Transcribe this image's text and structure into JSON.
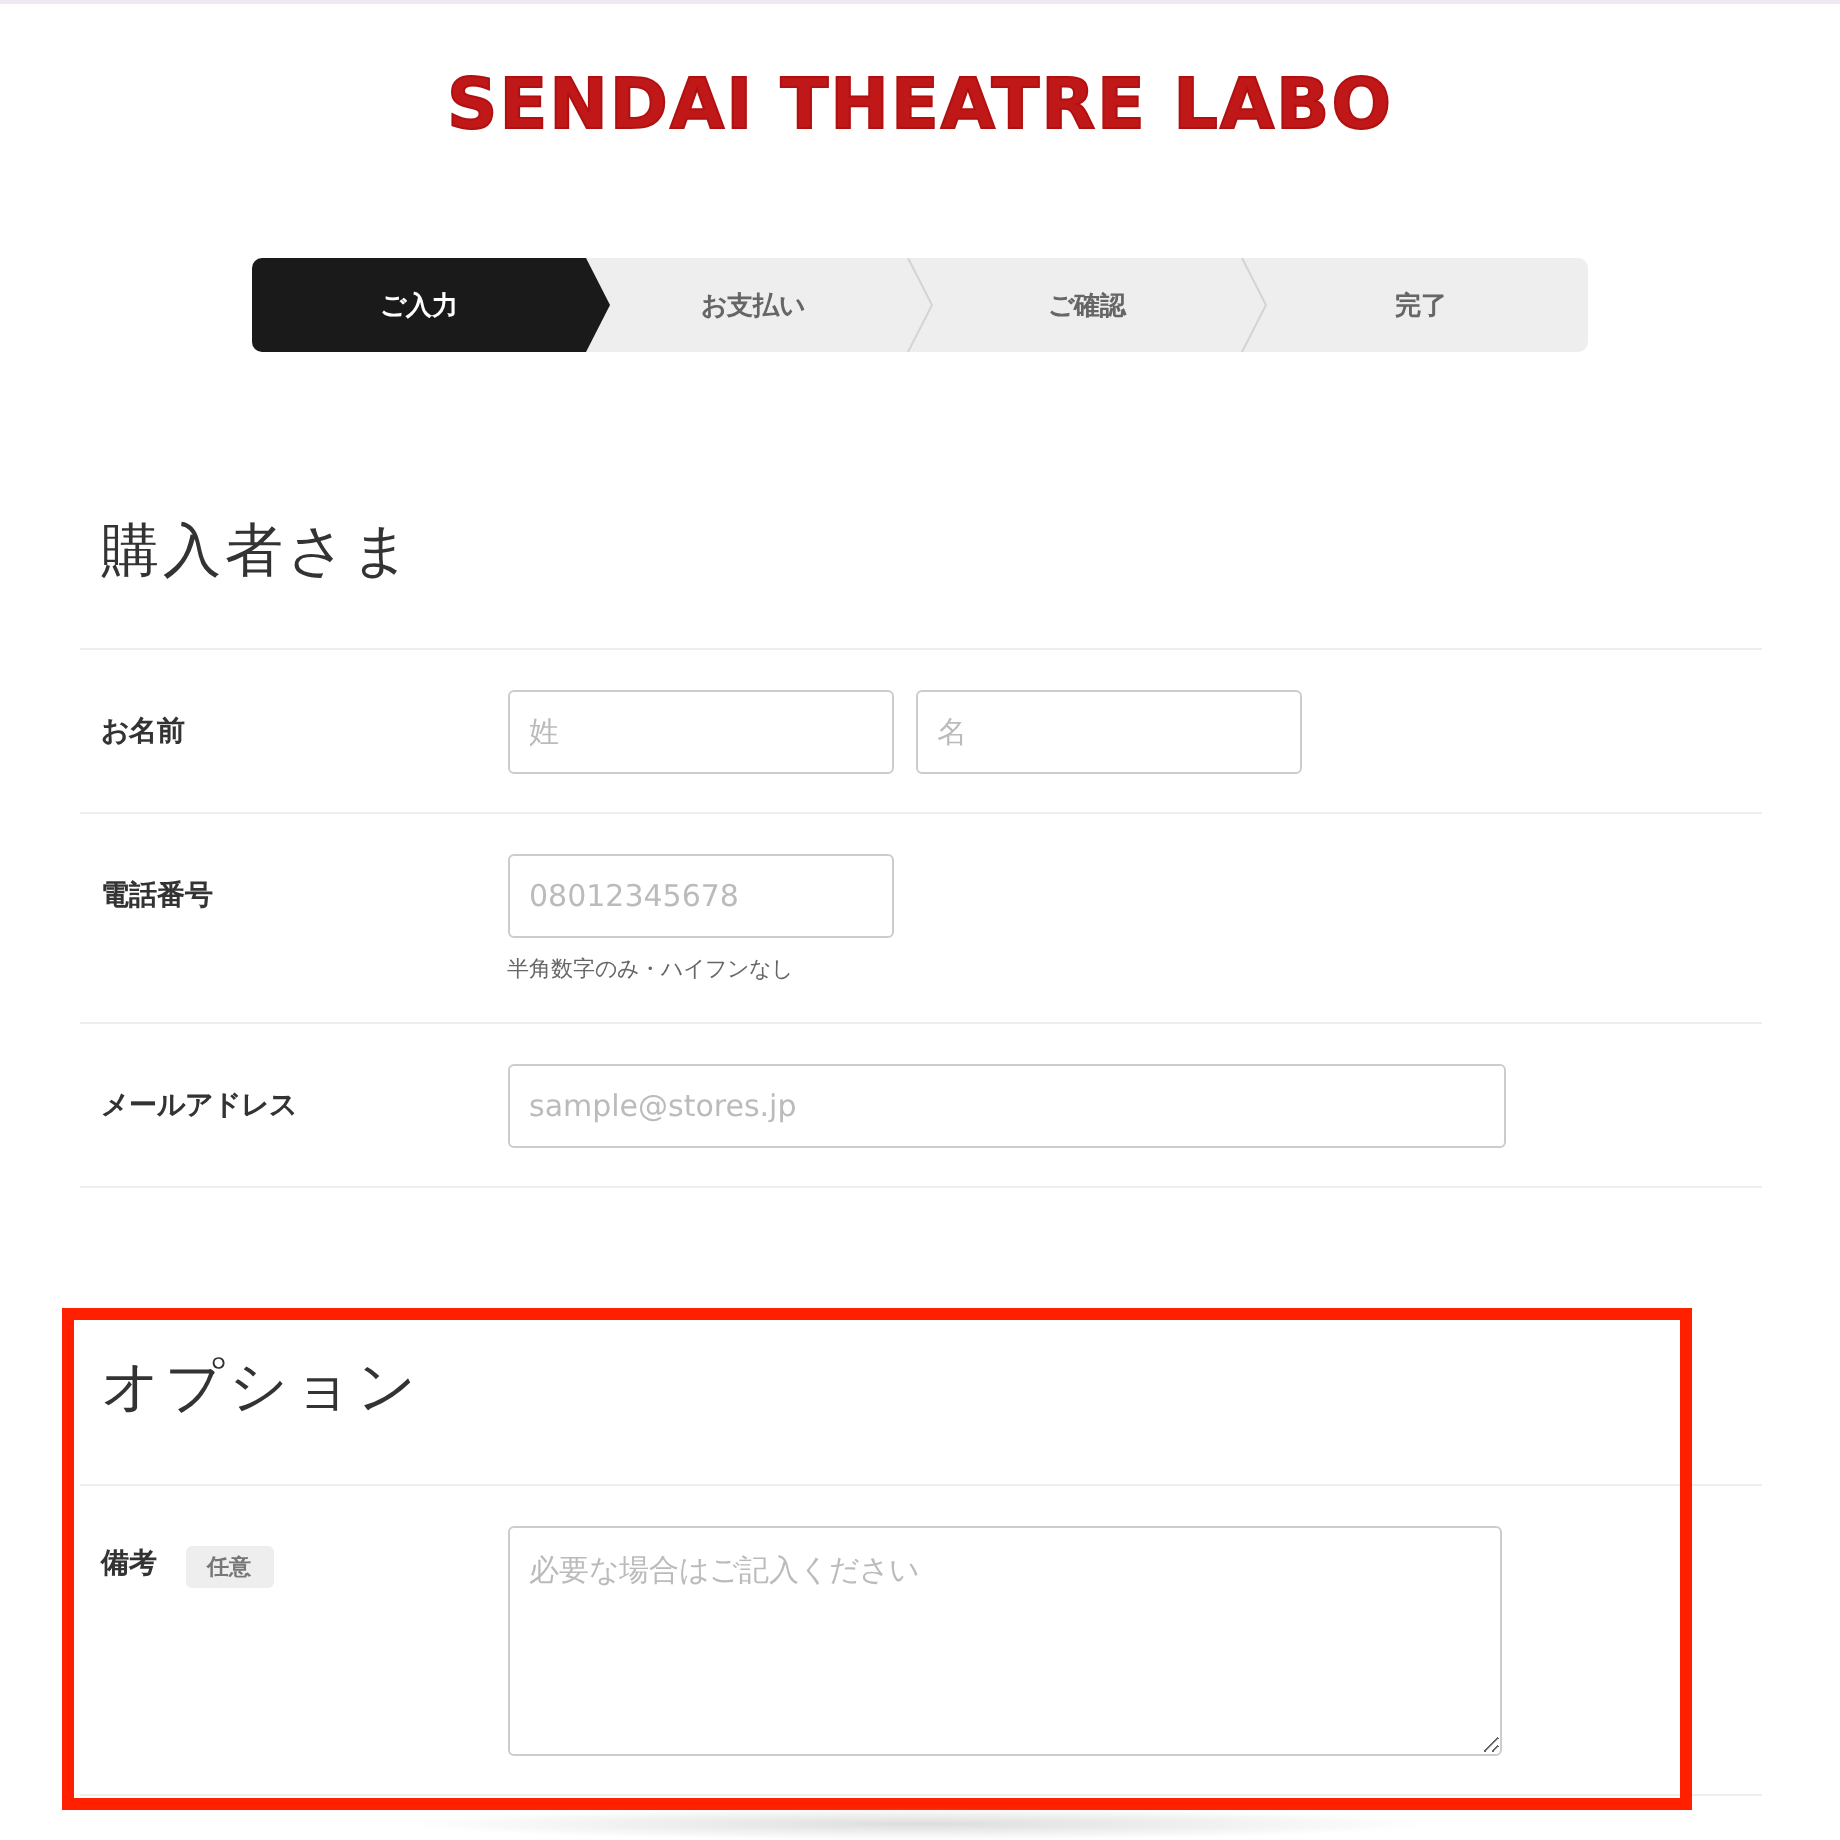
{
  "logo": {
    "text": "SENDAI THEATRE LABO"
  },
  "steps": [
    {
      "label": "ご入力",
      "selected": true
    },
    {
      "label": "お支払い",
      "selected": false
    },
    {
      "label": "ご確認",
      "selected": false
    },
    {
      "label": "完了",
      "selected": false
    }
  ],
  "sections": [
    {
      "title": "購入者さま",
      "highlighted": false,
      "rows": [
        {
          "label": "お名前",
          "fields": [
            {
              "kind": "short",
              "placeholder": "姓"
            },
            {
              "kind": "short",
              "placeholder": "名"
            }
          ]
        },
        {
          "label": "電話番号",
          "fields": [
            {
              "kind": "short",
              "placeholder": "08012345678"
            }
          ],
          "hint": "半角数字のみ・ハイフンなし"
        },
        {
          "label": "メールアドレス",
          "fields": [
            {
              "kind": "wide",
              "placeholder": "sample@stores.jp"
            }
          ]
        }
      ]
    },
    {
      "title": "オプション",
      "highlighted": true,
      "rows": [
        {
          "label": "備考",
          "badge": "任意",
          "fields": [
            {
              "kind": "textarea",
              "placeholder": "必要な場合はご記入ください"
            }
          ]
        }
      ]
    }
  ]
}
